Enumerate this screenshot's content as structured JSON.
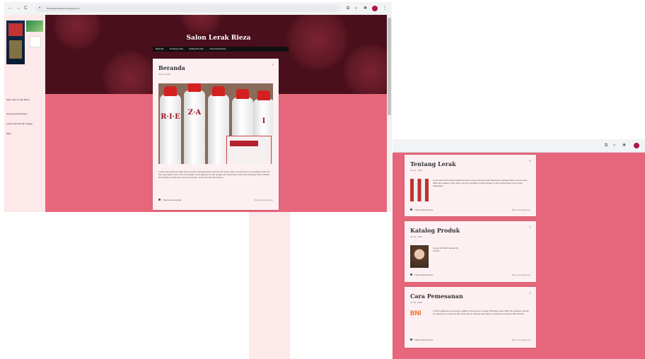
{
  "browser": {
    "nav_back": "←",
    "nav_forward": "→",
    "nav_reload": "C",
    "url": "bioziasalonlerakrieza.blogspot.com"
  },
  "sidebar": {
    "links": [
      "Tags: Salon Lerak Rieza",
      "Semua Lerak Pakaian",
      "Lerak untuk Rumah Tangga",
      "Batik"
    ]
  },
  "blog": {
    "title": "Salon Lerak Rieza",
    "menu": [
      "Beranda",
      "Tentang Lerak",
      "Katalog Produk",
      "Cara Pemesanan"
    ]
  },
  "main_post": {
    "title": "Beranda",
    "date": "Juli 11, 2018",
    "bottle_letters": [
      "R·I·E",
      "Z·A",
      "I"
    ],
    "body": "Lerak sudah dikenal sejak zaman dahulu sebagai bahan pencuci kain batik. Salon Lerak Rieza menyediakan lerak asli dan siap pakai untuk mencuci pakaian, perlengkapan rumah tangga dan kebutuhan sehari-hari keluarga Anda. Silakan lihat katalog produk dan cara pemesanan untuk informasi lebih lanjut.",
    "comment": "Tidak ada komentar",
    "read_more": "Baca selengkapnya"
  },
  "cards": [
    {
      "title": "Tentang Lerak",
      "date": "Juli 11, 2018",
      "body": "Lerak atau buah klerak adalah tanaman yang buahnya dapat digunakan sebagai bahan pencuci kain batik dan pakaian, juga untuk mencuci peralatan rumah tangga. Lerak bersifat alami dan ramah lingkungan.",
      "comment": "Tidak ada komentar",
      "read_more": "Baca selengkapnya"
    },
    {
      "title": "Katalog Produk",
      "date": "Juli 11, 2018",
      "body": "Lerak cair 250ml Harga Rp 15.000",
      "comment": "Tidak ada komentar",
      "read_more": "Baca selengkapnya"
    },
    {
      "title": "Cara Pemesanan",
      "date": "Juli 11, 2018",
      "logo": "BNI",
      "body": "Untuk melakukan pemesanan silakan hubungi kami melalui WhatsApp atau SMS, lalu lakukan transfer pembayaran ke rekening BNI yang tertera. Barang akan dikirim setelah pembayaran dikonfirmasi.",
      "comment": "Tidak ada komentar",
      "read_more": "Baca selengkapnya"
    }
  ],
  "colors": {
    "page_pink": "#e6677b",
    "banner": "#4a0f1c",
    "card": "#fdf0f2",
    "avatar": "#b0154a"
  }
}
